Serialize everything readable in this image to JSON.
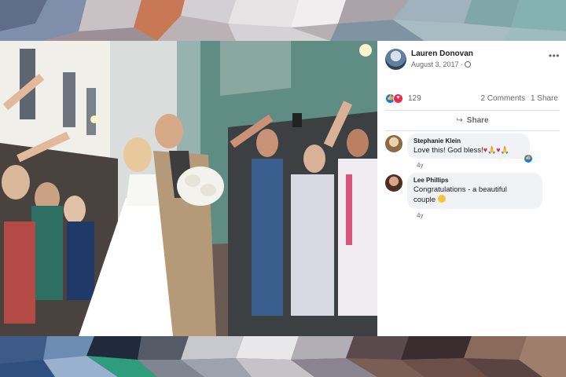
{
  "post": {
    "author": "Lauren Donovan",
    "date": "August 3, 2017 ·",
    "more_icon": "ellipsis-icon"
  },
  "reactions": {
    "icons": [
      "like-icon",
      "love-icon"
    ],
    "count": "129",
    "comments": "2 Comments",
    "shares": "1 Share"
  },
  "actions": {
    "share_label": "Share"
  },
  "comments": [
    {
      "name": "Stephanie Klein",
      "text": "Love this! God bless!",
      "emojis": [
        "red-heart",
        "folded-hands",
        "red-heart",
        "folded-hands"
      ],
      "time": "4y"
    },
    {
      "name": "Lee Phillips",
      "text_line1": "Congratulations - a beautiful",
      "text_line2": "couple",
      "emoji": "smiling-face",
      "time": "4y"
    }
  ],
  "colors": {
    "facebook_blue": "#1877f2",
    "love_red": "#f0284a",
    "bubble_gray": "#f0f2f5",
    "muted_text": "#65676b"
  }
}
